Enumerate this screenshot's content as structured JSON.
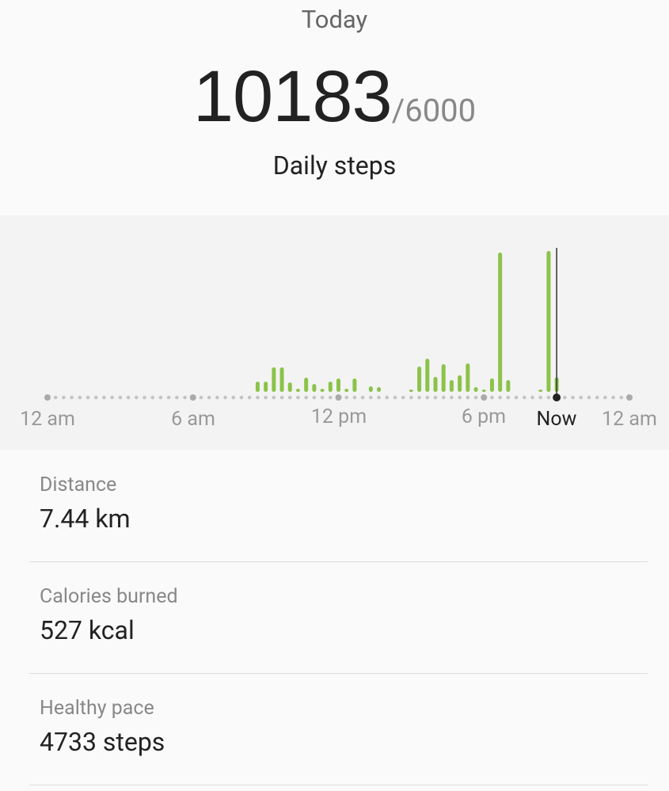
{
  "header": {
    "title": "Today",
    "steps": "10183",
    "goal": "/6000",
    "label": "Daily steps"
  },
  "chart_data": {
    "type": "bar",
    "interval_minutes": 20,
    "x_tick_labels": [
      "12 am",
      "6 am",
      "12 pm",
      "6 pm",
      "12 am"
    ],
    "now_label": "Now",
    "now_time": "21:00",
    "bar_color": "#8bc34a",
    "bars": [
      {
        "time": "08:40",
        "steps": 162
      },
      {
        "time": "09:00",
        "steps": 162
      },
      {
        "time": "09:20",
        "steps": 385
      },
      {
        "time": "09:40",
        "steps": 385
      },
      {
        "time": "10:00",
        "steps": 149
      },
      {
        "time": "10:20",
        "steps": 50
      },
      {
        "time": "10:40",
        "steps": 224
      },
      {
        "time": "11:00",
        "steps": 124
      },
      {
        "time": "11:20",
        "steps": 50
      },
      {
        "time": "11:40",
        "steps": 162
      },
      {
        "time": "12:00",
        "steps": 211
      },
      {
        "time": "12:20",
        "steps": 50
      },
      {
        "time": "12:40",
        "steps": 211
      },
      {
        "time": "13:20",
        "steps": 87
      },
      {
        "time": "13:40",
        "steps": 75
      },
      {
        "time": "15:00",
        "steps": 37
      },
      {
        "time": "15:20",
        "steps": 398
      },
      {
        "time": "15:40",
        "steps": 522
      },
      {
        "time": "16:00",
        "steps": 236
      },
      {
        "time": "16:20",
        "steps": 435
      },
      {
        "time": "16:40",
        "steps": 186
      },
      {
        "time": "17:00",
        "steps": 261
      },
      {
        "time": "17:20",
        "steps": 447
      },
      {
        "time": "17:40",
        "steps": 75
      },
      {
        "time": "18:00",
        "steps": 37
      },
      {
        "time": "18:20",
        "steps": 211
      },
      {
        "time": "18:40",
        "steps": 2187
      },
      {
        "time": "19:00",
        "steps": 186
      },
      {
        "time": "20:20",
        "steps": 37
      },
      {
        "time": "20:40",
        "steps": 2212
      },
      {
        "time": "21:00",
        "steps": 229
      }
    ]
  },
  "stats": [
    {
      "label": "Distance",
      "value": "7.44 km"
    },
    {
      "label": "Calories burned",
      "value": "527 kcal"
    },
    {
      "label": "Healthy pace",
      "value": "4733 steps"
    }
  ]
}
